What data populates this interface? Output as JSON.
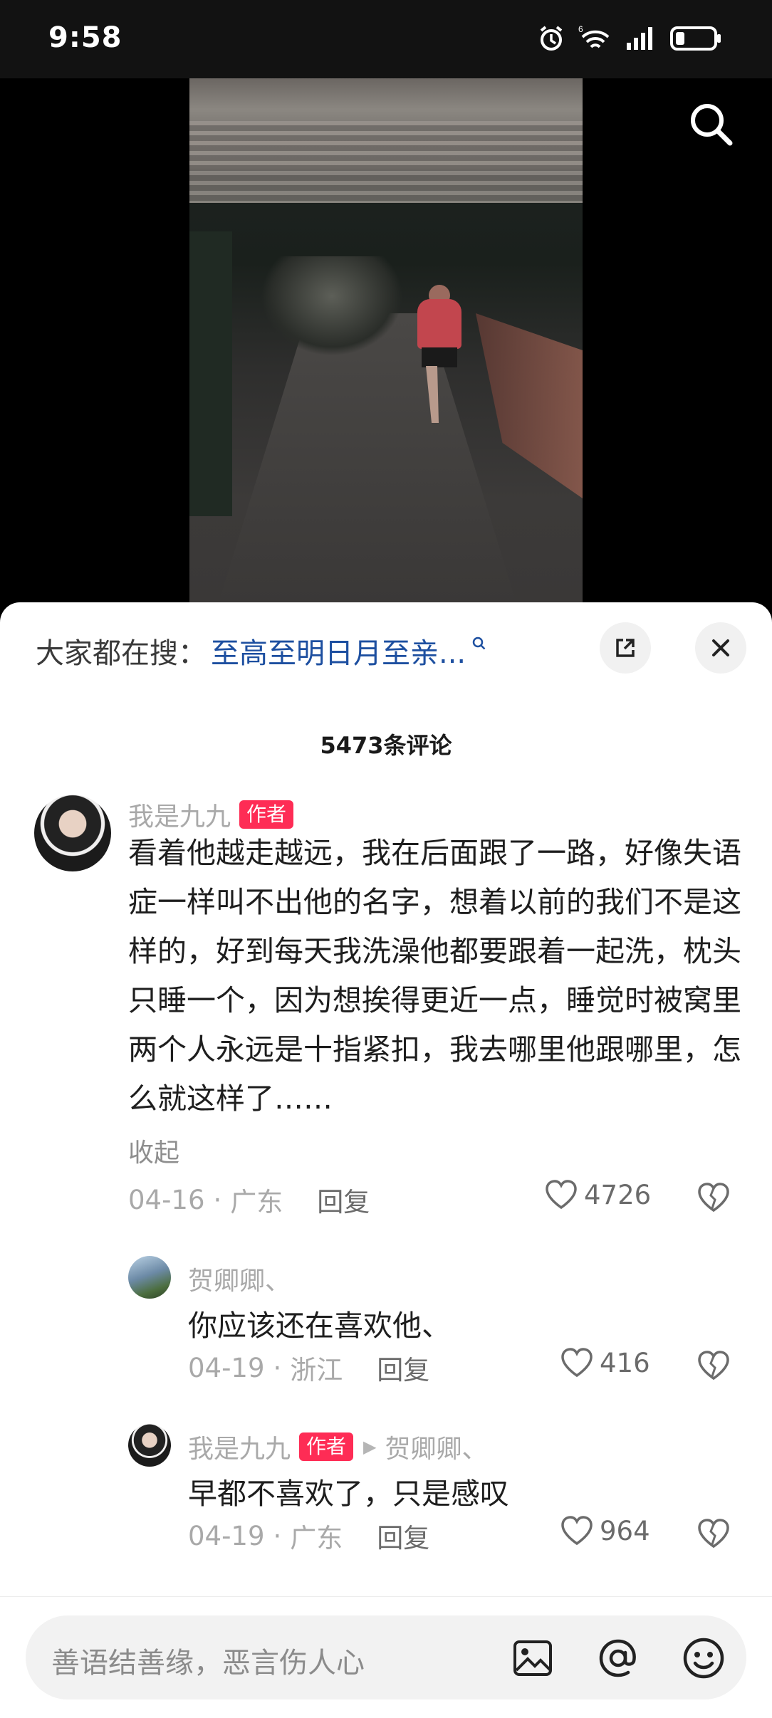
{
  "status_bar": {
    "time": "9:58",
    "icons": [
      "alarm-icon",
      "wifi-6-icon",
      "signal-icon",
      "battery-icon"
    ]
  },
  "video": {
    "search_icon": "search-icon"
  },
  "hot_search": {
    "prefix": "大家都在搜：",
    "query": "至高至明日月至亲...",
    "expand_icon": "expand-icon",
    "close_icon": "close-icon"
  },
  "comment_count": "5473条评论",
  "comments": [
    {
      "author": "我是九九",
      "badge": "作者",
      "text": "看着他越走越远，我在后面跟了一路，好像失语症一样叫不出他的名字，想着以前的我们不是这样的，好到每天我洗澡他都要跟着一起洗，枕头只睡一个，因为想挨得更近一点，睡觉时被窝里两个人永远是十指紧扣，我去哪里他跟哪里，怎么就这样了……",
      "collapse": "收起",
      "date": "04-16",
      "location": "广东",
      "reply": "回复",
      "likes": "4726"
    },
    {
      "author": "贺卿卿、",
      "text": "你应该还在喜欢他、",
      "date": "04-19",
      "location": "浙江",
      "reply": "回复",
      "likes": "416"
    },
    {
      "author": "我是九九",
      "badge": "作者",
      "reply_to": "贺卿卿、",
      "text": "早都不喜欢了，只是感叹",
      "date": "04-19",
      "location": "广东",
      "reply": "回复",
      "likes": "964"
    }
  ],
  "input": {
    "placeholder": "善语结善缘，恶言伤人心",
    "icons": [
      "image-icon",
      "at-icon",
      "emoji-icon"
    ]
  },
  "colors": {
    "author_badge": "#fe2c55",
    "hot_search_link": "#1d4fa0"
  }
}
